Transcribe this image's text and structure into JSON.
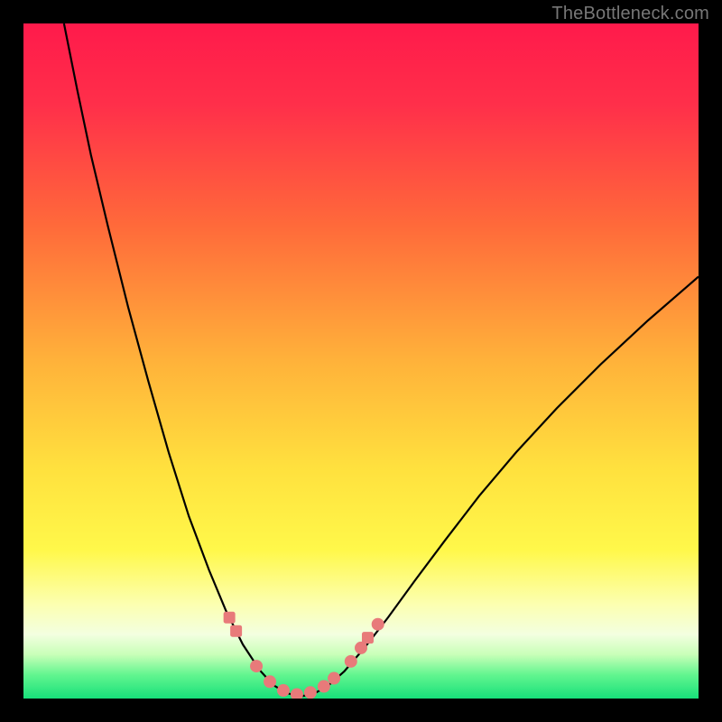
{
  "watermark": "TheBottleneck.com",
  "chart_data": {
    "type": "line",
    "title": "",
    "xlabel": "",
    "ylabel": "",
    "xlim": [
      0,
      100
    ],
    "ylim": [
      0,
      100
    ],
    "gradient_stops": [
      {
        "offset": 0.0,
        "color": "#ff1a4b"
      },
      {
        "offset": 0.12,
        "color": "#ff2f4a"
      },
      {
        "offset": 0.3,
        "color": "#ff6a3a"
      },
      {
        "offset": 0.5,
        "color": "#ffb23a"
      },
      {
        "offset": 0.66,
        "color": "#ffe13e"
      },
      {
        "offset": 0.78,
        "color": "#fff84a"
      },
      {
        "offset": 0.86,
        "color": "#fcffb0"
      },
      {
        "offset": 0.905,
        "color": "#f3ffe0"
      },
      {
        "offset": 0.935,
        "color": "#c8ffb8"
      },
      {
        "offset": 0.965,
        "color": "#62f58f"
      },
      {
        "offset": 1.0,
        "color": "#17e07a"
      }
    ],
    "series": [
      {
        "name": "bottleneck-curve",
        "note": "x is normalized 0..100, y is bottleneck percent (0 bottom, 100 top)",
        "points": [
          {
            "x": 6.0,
            "y": 100.0
          },
          {
            "x": 8.0,
            "y": 90.0
          },
          {
            "x": 10.0,
            "y": 80.5
          },
          {
            "x": 12.5,
            "y": 70.0
          },
          {
            "x": 15.5,
            "y": 58.0
          },
          {
            "x": 18.5,
            "y": 47.0
          },
          {
            "x": 21.5,
            "y": 36.5
          },
          {
            "x": 24.5,
            "y": 27.0
          },
          {
            "x": 27.5,
            "y": 19.0
          },
          {
            "x": 30.0,
            "y": 13.0
          },
          {
            "x": 32.5,
            "y": 8.0
          },
          {
            "x": 35.0,
            "y": 4.2
          },
          {
            "x": 37.0,
            "y": 2.0
          },
          {
            "x": 39.0,
            "y": 0.8
          },
          {
            "x": 41.0,
            "y": 0.3
          },
          {
            "x": 43.0,
            "y": 0.7
          },
          {
            "x": 45.0,
            "y": 1.8
          },
          {
            "x": 47.5,
            "y": 4.0
          },
          {
            "x": 50.5,
            "y": 7.5
          },
          {
            "x": 54.0,
            "y": 12.0
          },
          {
            "x": 58.0,
            "y": 17.5
          },
          {
            "x": 62.5,
            "y": 23.5
          },
          {
            "x": 67.5,
            "y": 30.0
          },
          {
            "x": 73.0,
            "y": 36.5
          },
          {
            "x": 79.0,
            "y": 43.0
          },
          {
            "x": 85.5,
            "y": 49.5
          },
          {
            "x": 92.5,
            "y": 56.0
          },
          {
            "x": 100.0,
            "y": 62.5
          }
        ]
      }
    ],
    "markers": [
      {
        "shape": "square",
        "x": 30.5,
        "y": 12.0
      },
      {
        "shape": "square",
        "x": 31.5,
        "y": 10.0
      },
      {
        "shape": "circle",
        "x": 34.5,
        "y": 4.8
      },
      {
        "shape": "circle",
        "x": 36.5,
        "y": 2.5
      },
      {
        "shape": "circle",
        "x": 38.5,
        "y": 1.2
      },
      {
        "shape": "circle",
        "x": 40.5,
        "y": 0.6
      },
      {
        "shape": "circle",
        "x": 42.5,
        "y": 0.9
      },
      {
        "shape": "circle",
        "x": 44.5,
        "y": 1.8
      },
      {
        "shape": "circle",
        "x": 46.0,
        "y": 3.0
      },
      {
        "shape": "circle",
        "x": 48.5,
        "y": 5.5
      },
      {
        "shape": "circle",
        "x": 50.0,
        "y": 7.5
      },
      {
        "shape": "square",
        "x": 51.0,
        "y": 9.0
      },
      {
        "shape": "circle",
        "x": 52.5,
        "y": 11.0
      }
    ],
    "marker_color": "#e87a7a",
    "curve_color": "#000000"
  }
}
